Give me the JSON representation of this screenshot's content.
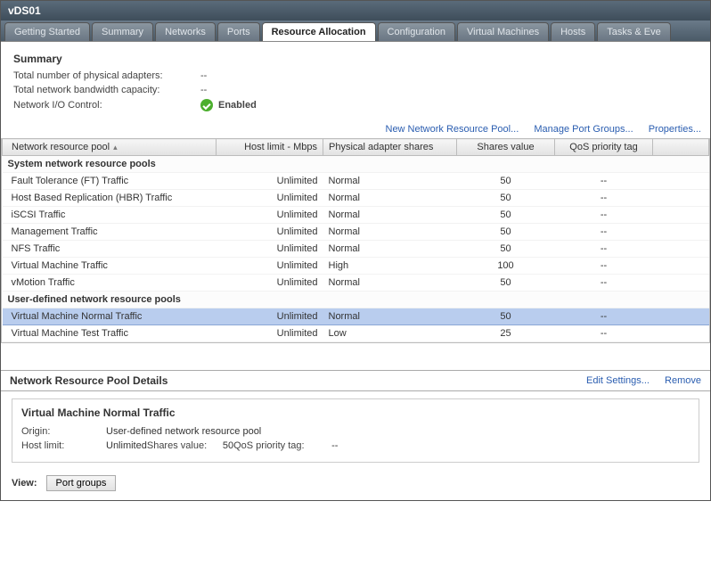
{
  "title": "vDS01",
  "tabs": [
    {
      "label": "Getting Started",
      "active": false
    },
    {
      "label": "Summary",
      "active": false
    },
    {
      "label": "Networks",
      "active": false
    },
    {
      "label": "Ports",
      "active": false
    },
    {
      "label": "Resource Allocation",
      "active": true
    },
    {
      "label": "Configuration",
      "active": false
    },
    {
      "label": "Virtual Machines",
      "active": false
    },
    {
      "label": "Hosts",
      "active": false
    },
    {
      "label": "Tasks & Eve",
      "active": false
    }
  ],
  "summary": {
    "heading": "Summary",
    "rows": [
      {
        "label": "Total number of physical adapters:",
        "value": "--"
      },
      {
        "label": "Total network bandwidth capacity:",
        "value": "--"
      }
    ],
    "nic_label": "Network I/O Control:",
    "nic_value": "Enabled"
  },
  "toolbar": {
    "new_pool": "New Network Resource Pool...",
    "manage_pg": "Manage Port Groups...",
    "properties": "Properties..."
  },
  "columns": {
    "c0": "Network resource pool",
    "c1": "Host limit - Mbps",
    "c2": "Physical adapter shares",
    "c3": "Shares value",
    "c4": "QoS priority tag"
  },
  "groups": [
    {
      "name": "System network resource pools",
      "rows": [
        {
          "name": "Fault Tolerance (FT) Traffic",
          "limit": "Unlimited",
          "shares": "Normal",
          "sval": "50",
          "qos": "--",
          "selected": false
        },
        {
          "name": "Host Based Replication (HBR) Traffic",
          "limit": "Unlimited",
          "shares": "Normal",
          "sval": "50",
          "qos": "--",
          "selected": false
        },
        {
          "name": "iSCSI Traffic",
          "limit": "Unlimited",
          "shares": "Normal",
          "sval": "50",
          "qos": "--",
          "selected": false
        },
        {
          "name": "Management Traffic",
          "limit": "Unlimited",
          "shares": "Normal",
          "sval": "50",
          "qos": "--",
          "selected": false
        },
        {
          "name": "NFS Traffic",
          "limit": "Unlimited",
          "shares": "Normal",
          "sval": "50",
          "qos": "--",
          "selected": false
        },
        {
          "name": "Virtual Machine Traffic",
          "limit": "Unlimited",
          "shares": "High",
          "sval": "100",
          "qos": "--",
          "selected": false
        },
        {
          "name": "vMotion Traffic",
          "limit": "Unlimited",
          "shares": "Normal",
          "sval": "50",
          "qos": "--",
          "selected": false
        }
      ]
    },
    {
      "name": "User-defined network resource pools",
      "rows": [
        {
          "name": "Virtual Machine Normal Traffic",
          "limit": "Unlimited",
          "shares": "Normal",
          "sval": "50",
          "qos": "--",
          "selected": true
        },
        {
          "name": "Virtual Machine Test Traffic",
          "limit": "Unlimited",
          "shares": "Low",
          "sval": "25",
          "qos": "--",
          "selected": false
        }
      ]
    }
  ],
  "details": {
    "heading": "Network Resource Pool Details",
    "edit": "Edit Settings...",
    "remove": "Remove",
    "name": "Virtual Machine Normal Traffic",
    "origin_k": "Origin:",
    "origin_v": "User-defined network resource pool",
    "limit_k": "Host limit:",
    "limit_v": "Unlimited",
    "sval_k": "Shares value:",
    "sval_v": "50",
    "qos_k": "QoS priority tag:",
    "qos_v": "--"
  },
  "view": {
    "label": "View:",
    "button": "Port groups"
  }
}
